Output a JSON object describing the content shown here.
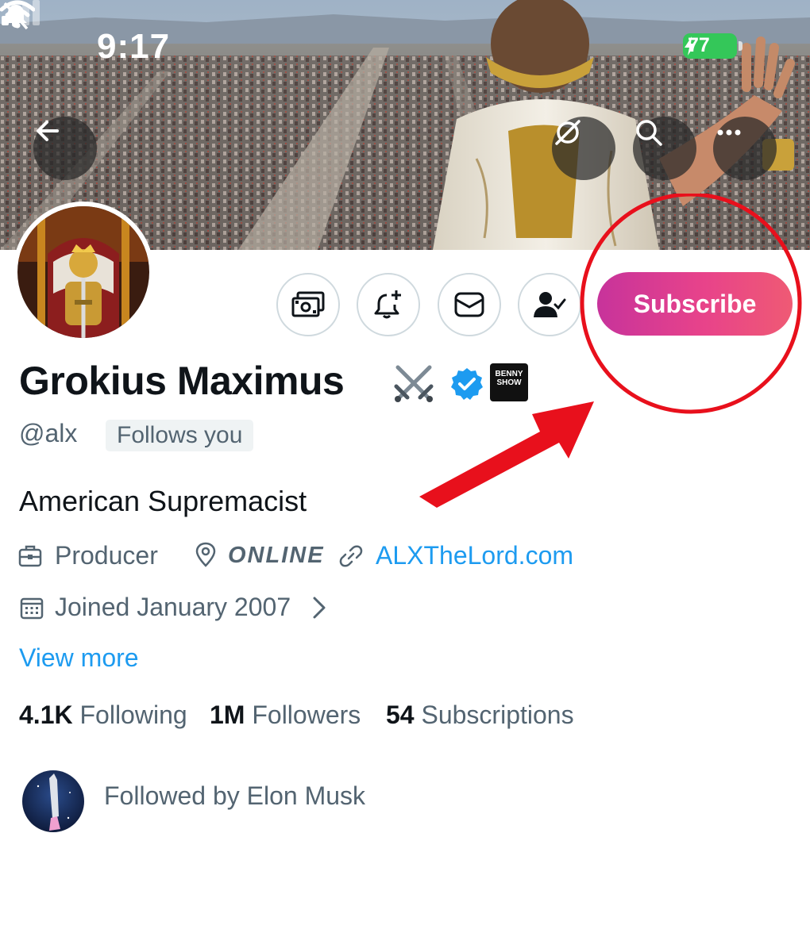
{
  "status_bar": {
    "time": "9:17",
    "battery": "77"
  },
  "header_icons": {
    "back": "arrow-left-icon",
    "grok": "grok-icon",
    "search": "search-icon",
    "more": "more-horizontal-icon"
  },
  "actions": {
    "tip": "money-icon",
    "notify": "bell-plus-icon",
    "message": "envelope-icon",
    "following": "person-check-icon",
    "subscribe_label": "Subscribe"
  },
  "profile": {
    "name": "Grokius Maximus",
    "name_emoji": "crossed-swords",
    "affiliate_badge": "BENNY SHOW",
    "handle": "@alx",
    "follows_you": "Follows you",
    "bio": "American Supremacist",
    "profession": "Producer",
    "location": "ONLINE",
    "website": "ALXTheLord.com",
    "joined": "Joined January 2007",
    "view_more": "View more"
  },
  "stats": {
    "following_count": "4.1K",
    "following_label": "Following",
    "followers_count": "1M",
    "followers_label": "Followers",
    "subscriptions_count": "54",
    "subscriptions_label": "Subscriptions"
  },
  "followed_by": {
    "text": "Followed by Elon Musk"
  },
  "colors": {
    "link": "#1d9bf0",
    "secondary_text": "#536471",
    "subscribe_gradient_start": "#c7339b",
    "subscribe_gradient_end": "#ef5a74",
    "annotation_red": "#e8101c",
    "battery_green": "#34c759"
  }
}
